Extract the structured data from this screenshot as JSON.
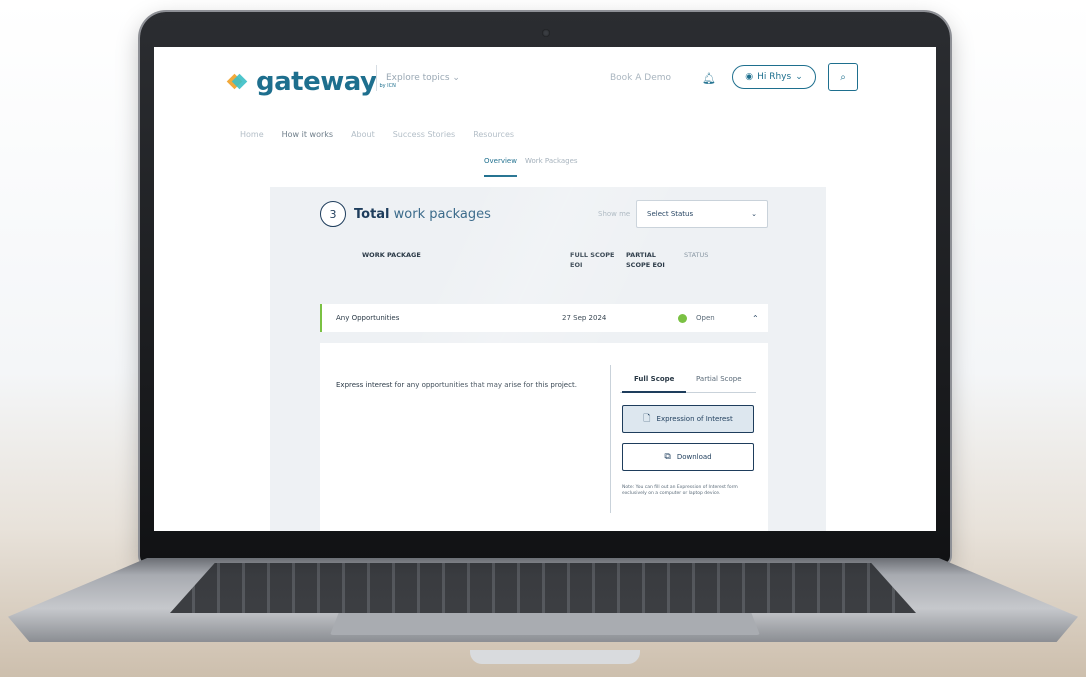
{
  "header": {
    "logo_text": "gateway",
    "logo_sub": "by ICN",
    "explore_label": "Explore topics",
    "book_demo_label": "Book A Demo",
    "user_label": "Hi Rhys"
  },
  "nav": {
    "items": [
      "Home",
      "How it works",
      "About",
      "Success Stories",
      "Resources"
    ],
    "active": "How it works"
  },
  "subtabs": [
    "Overview",
    "Work Packages"
  ],
  "summary": {
    "count": "3",
    "title_bold": "Total",
    "title_rest": "work packages",
    "show_me_label": "Show me",
    "status_select_value": "Select Status"
  },
  "columns": {
    "work_package": "WORK PACKAGE",
    "full_scope_eoi_1": "FULL SCOPE",
    "full_scope_eoi_2": "EOI",
    "partial_scope_eoi_1": "PARTIAL",
    "partial_scope_eoi_2": "SCOPE EOI",
    "status": "STATUS"
  },
  "row": {
    "name": "Any Opportunities",
    "full_scope_date": "27 Sep 2024",
    "status": "Open",
    "status_color": "#7ac143"
  },
  "detail": {
    "description": "Express interest for any opportunities that may arise for this project.",
    "tab_full": "Full Scope",
    "tab_partial": "Partial Scope",
    "eoi_button": "Expression of Interest",
    "download_button": "Download",
    "note": "Note: You can fill out an Expression of Interest form exclusively on a computer or laptop device."
  },
  "colors": {
    "brand": "#1e6f8e",
    "navy": "#1e3d5c",
    "accent_green": "#7ac143",
    "logo_orange": "#f2a93b",
    "logo_teal": "#3bbfc6"
  }
}
